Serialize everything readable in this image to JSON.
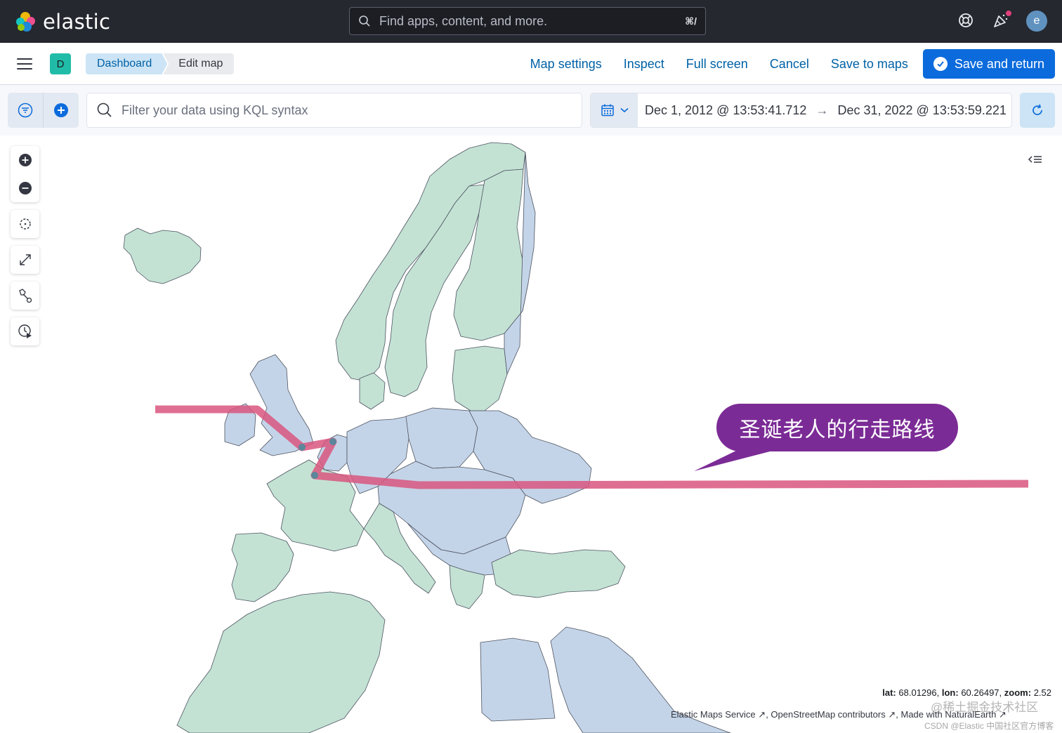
{
  "header": {
    "brand": "elastic",
    "search_placeholder": "Find apps, content, and more.",
    "search_shortcut": "⌘/",
    "avatar_initial": "e"
  },
  "nav": {
    "space_initial": "D",
    "breadcrumbs": [
      "Dashboard",
      "Edit map"
    ],
    "links": [
      "Map settings",
      "Inspect",
      "Full screen",
      "Cancel",
      "Save to maps"
    ],
    "primary_button": "Save and return"
  },
  "query": {
    "placeholder": "Filter your data using KQL syntax",
    "date_start": "Dec 1, 2012 @ 13:53:41.712",
    "date_arrow": "→",
    "date_end": "Dec 31, 2022 @ 13:53:59.221"
  },
  "map": {
    "callout": "圣诞老人的行走路线",
    "coords": {
      "lat_label": "lat:",
      "lat": "68.01296",
      "lon_label": "lon:",
      "lon": "60.26497",
      "zoom_label": "zoom:",
      "zoom": "2.52"
    },
    "attribution": [
      "Elastic Maps Service",
      "OpenStreetMap contributors",
      "Made with NaturalEarth"
    ],
    "watermark_1": "@稀土掘金技术社区",
    "watermark_2": "CSDN @Elastic 中国社区官方博客",
    "colors": {
      "land_green": "#c3e2d4",
      "land_blue": "#c4d4e8",
      "route": "#d9567f",
      "callout": "#7b2b96"
    }
  }
}
